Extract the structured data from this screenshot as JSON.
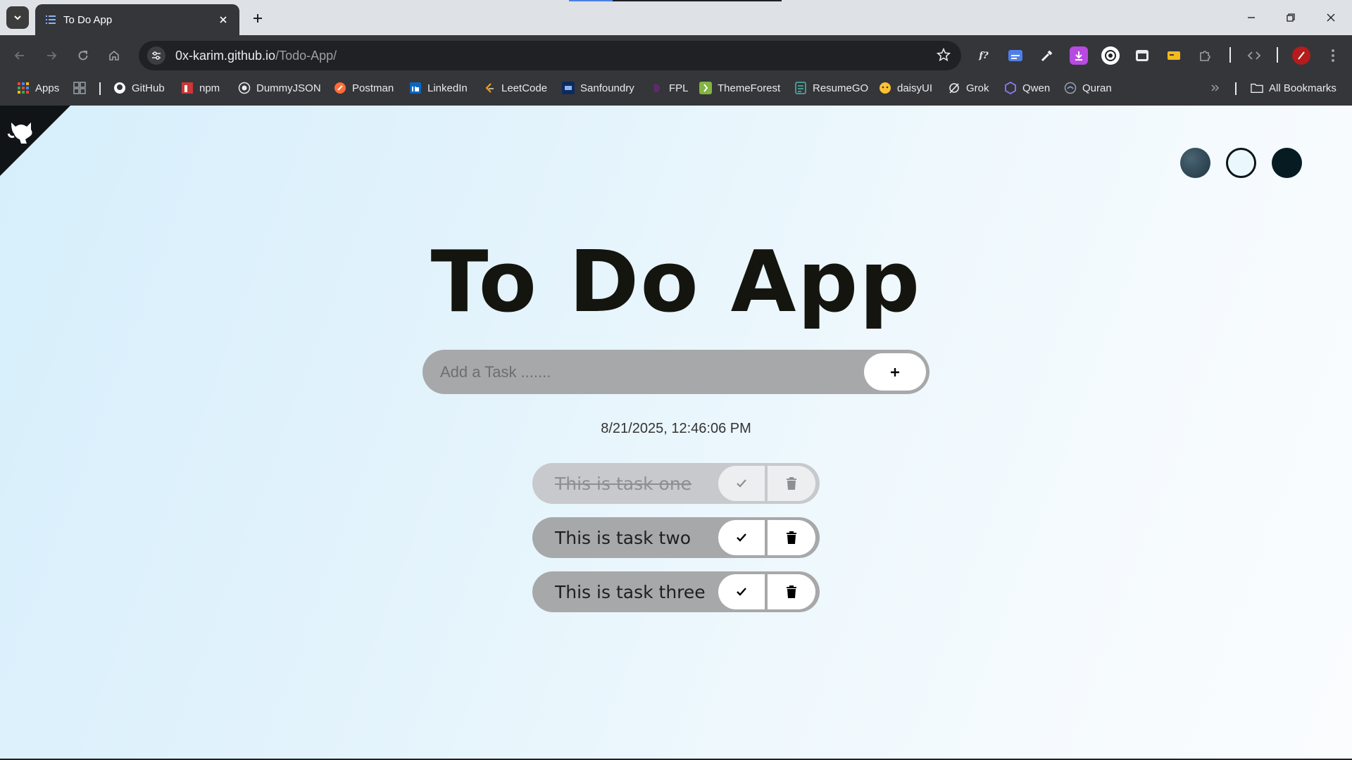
{
  "browser": {
    "tab": {
      "title": "To Do App",
      "favicon": "list-icon"
    },
    "url": {
      "host": "0x-karim.github.io",
      "path": "/Todo-App/"
    },
    "extensions": [
      {
        "label": "f?",
        "icon": "font-finder-icon"
      },
      {
        "label": "",
        "icon": "translate-icon"
      },
      {
        "label": "",
        "icon": "eyedropper-icon"
      },
      {
        "label": "",
        "icon": "download-icon"
      },
      {
        "label": "",
        "icon": "extension-circle-icon"
      },
      {
        "label": "",
        "icon": "window-icon"
      },
      {
        "label": "",
        "icon": "tag-icon"
      },
      {
        "label": "",
        "icon": "puzzle-icon"
      },
      {
        "label": "",
        "icon": "code-icon"
      }
    ],
    "bookmarks": [
      {
        "label": "Apps",
        "icon": "apps-grid-icon"
      },
      {
        "label": "GitHub",
        "icon": "github-icon"
      },
      {
        "label": "npm",
        "icon": "npm-icon"
      },
      {
        "label": "DummyJSON",
        "icon": "dummyjson-icon"
      },
      {
        "label": "Postman",
        "icon": "postman-icon"
      },
      {
        "label": "LinkedIn",
        "icon": "linkedin-icon"
      },
      {
        "label": "LeetCode",
        "icon": "leetcode-icon"
      },
      {
        "label": "Sanfoundry",
        "icon": "sanfoundry-icon"
      },
      {
        "label": "FPL",
        "icon": "fpl-icon"
      },
      {
        "label": "ThemeForest",
        "icon": "themeforest-icon"
      },
      {
        "label": "ResumeGO",
        "icon": "resumego-icon"
      },
      {
        "label": "daisyUI",
        "icon": "daisyui-icon"
      },
      {
        "label": "Grok",
        "icon": "grok-icon"
      },
      {
        "label": "Qwen",
        "icon": "qwen-icon"
      },
      {
        "label": "Quran",
        "icon": "quran-icon"
      }
    ],
    "all_bookmarks": "All Bookmarks"
  },
  "app": {
    "title": "To Do App",
    "input_placeholder": "Add a Task .......",
    "add_label": "+",
    "datetime": "8/21/2025, 12:46:06 PM",
    "themes": [
      {
        "name": "dark-slate",
        "color": "#2e4756"
      },
      {
        "name": "light",
        "color": "#eaf8fe"
      },
      {
        "name": "dark",
        "color": "#061c22"
      }
    ],
    "tasks": [
      {
        "text": "This is task one",
        "completed": true
      },
      {
        "text": "This is task two",
        "completed": false
      },
      {
        "text": "This is task three",
        "completed": false
      }
    ]
  }
}
